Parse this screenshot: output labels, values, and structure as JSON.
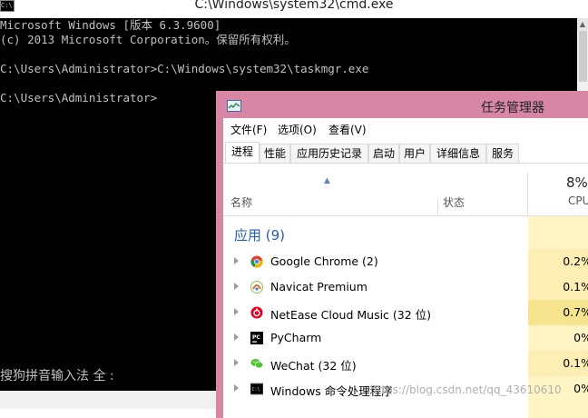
{
  "cmd": {
    "title": "C:\\Windows\\system32\\cmd.exe",
    "icon_text": "C:\\",
    "lines": [
      "Microsoft Windows [版本 6.3.9600]",
      "(c) 2013 Microsoft Corporation。保留所有权利。",
      "",
      "C:\\Users\\Administrator>C:\\Windows\\system32\\taskmgr.exe",
      "",
      "C:\\Users\\Administrator>"
    ],
    "ime_status": "搜狗拼音输入法 全 :"
  },
  "taskmgr": {
    "title": "任务管理器",
    "menu": [
      "文件(F)",
      "选项(O)",
      "查看(V)"
    ],
    "tabs": [
      "进程",
      "性能",
      "应用历史记录",
      "启动",
      "用户",
      "详细信息",
      "服务"
    ],
    "active_tab": "进程",
    "columns": {
      "name": "名称",
      "status": "状态",
      "cpu_percent": "8%",
      "cpu": "CPU"
    },
    "group_label": "应用 (9)",
    "apps": [
      {
        "name": "Google Chrome (2)",
        "cpu": "0.2%",
        "icon": "chrome-icon"
      },
      {
        "name": "Navicat Premium",
        "cpu": "0.1%",
        "icon": "navicat-icon"
      },
      {
        "name": "NetEase Cloud Music (32 位)",
        "cpu": "0.7%",
        "icon": "netease-music-icon"
      },
      {
        "name": "PyCharm",
        "cpu": "0%",
        "icon": "pycharm-icon"
      },
      {
        "name": "WeChat (32 位)",
        "cpu": "0.1%",
        "icon": "wechat-icon"
      },
      {
        "name": "Windows 命令处理程序",
        "cpu": "0%",
        "icon": "cmd-icon"
      }
    ]
  },
  "watermark": "https://blog.csdn.net/qq_43610610"
}
